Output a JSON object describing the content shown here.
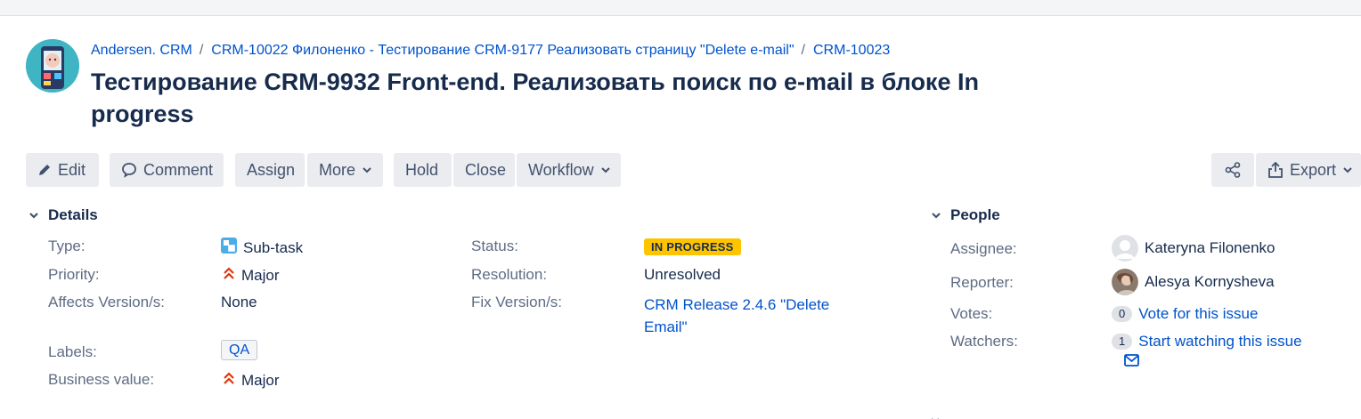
{
  "breadcrumb": {
    "project": "Andersen. CRM",
    "parent": "CRM-10022 Филоненко - Тестирование CRM-9177 Реализовать страницу \"Delete e-mail\"",
    "issue_key": "CRM-10023"
  },
  "issue": {
    "title": "Тестирование CRM-9932 Front-end. Реализовать поиск по e-mail в блоке In progress"
  },
  "toolbar": {
    "edit": "Edit",
    "comment": "Comment",
    "assign": "Assign",
    "more": "More",
    "hold": "Hold",
    "close": "Close",
    "workflow": "Workflow",
    "export": "Export"
  },
  "details": {
    "heading": "Details",
    "type_label": "Type:",
    "type_value": "Sub-task",
    "priority_label": "Priority:",
    "priority_value": "Major",
    "affects_label": "Affects Version/s:",
    "affects_value": "None",
    "labels_label": "Labels:",
    "labels_value": "QA",
    "business_label": "Business value:",
    "business_value": "Major",
    "status_label": "Status:",
    "status_value": "IN PROGRESS",
    "resolution_label": "Resolution:",
    "resolution_value": "Unresolved",
    "fix_label": "Fix Version/s:",
    "fix_value_line1": "CRM Release 2.4.6 \"Delete",
    "fix_value_line2": "Email\""
  },
  "people": {
    "heading": "People",
    "assignee_label": "Assignee:",
    "assignee_value": "Kateryna Filonenko",
    "reporter_label": "Reporter:",
    "reporter_value": "Alesya Kornysheva",
    "votes_label": "Votes:",
    "votes_count": "0",
    "votes_link": "Vote for this issue",
    "watchers_label": "Watchers:",
    "watchers_count": "1",
    "watchers_link": "Start watching this issue"
  },
  "colors": {
    "link": "#0052cc",
    "status_lozenge": "#ffc400",
    "button_bg": "#ebecf0",
    "priority_major": "#de350b"
  },
  "icons": {
    "project_avatar": "project-avatar",
    "edit": "pencil-icon",
    "comment": "comment-bubble-icon",
    "chevron": "chevron-down-icon",
    "share": "share-icon",
    "export": "export-icon",
    "subtask": "subtask-icon",
    "priority": "priority-major-icon",
    "email": "envelope-icon"
  }
}
